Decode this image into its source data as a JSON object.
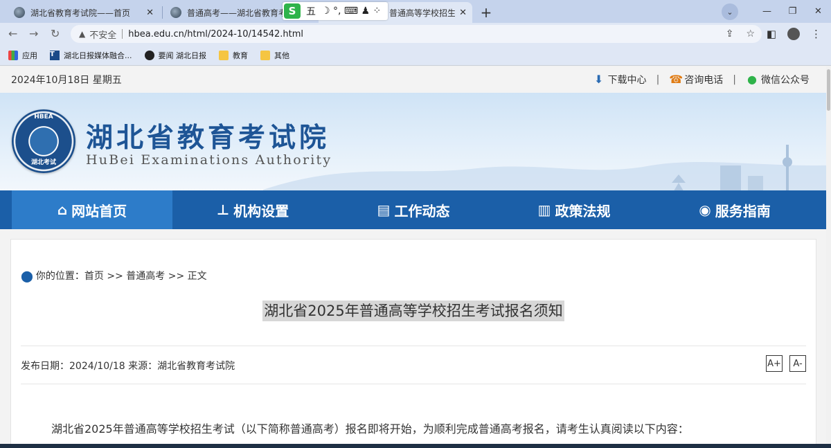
{
  "browser": {
    "tabs": [
      {
        "title": "湖北省教育考试院——首页"
      },
      {
        "title": "普通高考——湖北省教育考试院"
      },
      {
        "title": "普通高等学校招生"
      }
    ],
    "ime": {
      "logo": "S",
      "mode": "五",
      "symbols": "☽ °, ⌨ ♟ ⁘"
    },
    "window_controls": {
      "minimize": "—",
      "restore": "❐",
      "close": "✕"
    },
    "dropdown": "⌄",
    "new_tab": "+",
    "address": {
      "security_label": "不安全",
      "url": "hbea.edu.cn/html/2024-10/14542.html"
    },
    "bookmarks": [
      {
        "label": "应用",
        "icon": "apps-grid-icon"
      },
      {
        "label": "湖北日报媒体融合...",
        "icon": "t-logo-icon"
      },
      {
        "label": "要闻 湖北日报",
        "icon": "github-icon"
      },
      {
        "label": "教育",
        "icon": "folder-icon"
      },
      {
        "label": "其他",
        "icon": "folder-icon"
      }
    ]
  },
  "site": {
    "date": "2024年10月18日 星期五",
    "top_links": [
      {
        "label": "下载中心",
        "icon": "download-icon"
      },
      {
        "label": "咨询电话",
        "icon": "phone-icon"
      },
      {
        "label": "微信公众号",
        "icon": "wechat-icon"
      }
    ],
    "brand_cn": "湖北省教育考试院",
    "brand_en": "HuBei Examinations Authority",
    "emblem_top": "HBEA",
    "emblem_bottom": "湖北考试",
    "nav": [
      {
        "label": "网站首页",
        "icon": "home-icon",
        "active": true
      },
      {
        "label": "机构设置",
        "icon": "org-chart-icon",
        "active": false
      },
      {
        "label": "工作动态",
        "icon": "document-icon",
        "active": false
      },
      {
        "label": "政策法规",
        "icon": "book-icon",
        "active": false
      },
      {
        "label": "服务指南",
        "icon": "compass-icon",
        "active": false
      }
    ]
  },
  "article": {
    "breadcrumb": "你的位置：首页 >> 普通高考 >> 正文",
    "title": "湖北省2025年普通高等学校招生考试报名须知",
    "meta": "发布日期：2024/10/18  来源：湖北省教育考试院",
    "font_increase": "A+",
    "font_decrease": "A-",
    "first_paragraph": "湖北省2025年普通高等学校招生考试（以下简称普通高考）报名即将开始，为顺利完成普通高考报名，请考生认真阅读以下内容："
  },
  "colors": {
    "nav_bg": "#1b5fa8",
    "nav_active": "#2d7cc9",
    "brand": "#1e5596"
  }
}
